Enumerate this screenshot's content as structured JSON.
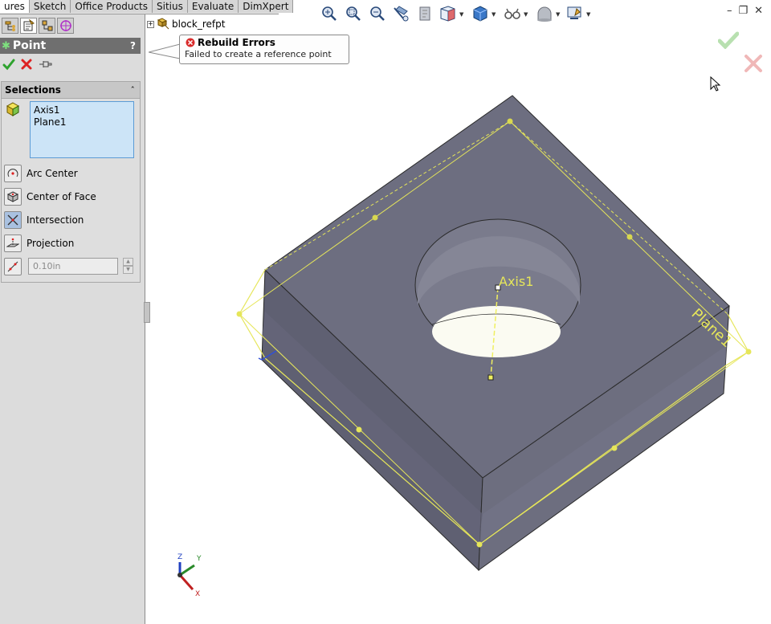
{
  "tabs": [
    {
      "label": "ures",
      "active": true
    },
    {
      "label": "Sketch",
      "active": false
    },
    {
      "label": "Office Products",
      "active": false
    },
    {
      "label": "Sitius",
      "active": false
    },
    {
      "label": "Evaluate",
      "active": false
    },
    {
      "label": "DimXpert",
      "active": false
    }
  ],
  "property_manager": {
    "title": "Point",
    "help": "?",
    "selections": {
      "header": "Selections",
      "items": [
        "Axis1",
        "Plane1"
      ]
    },
    "options": [
      {
        "label": "Arc Center",
        "icon": "arc-center-icon"
      },
      {
        "label": "Center of Face",
        "icon": "center-of-face-icon"
      },
      {
        "label": "Intersection",
        "icon": "intersection-icon"
      },
      {
        "label": "Projection",
        "icon": "projection-icon"
      }
    ],
    "distance": {
      "value": "0.10in"
    }
  },
  "tree": {
    "root": "block_refpt"
  },
  "rebuild_error": {
    "title": "Rebuild Errors",
    "message": "Failed to create a reference point"
  },
  "heads_up_icons": [
    "zoom-to-fit-icon",
    "zoom-to-area-icon",
    "previous-view-icon",
    "section-view-icon",
    "dynamic-annotation-icon",
    "view-orientation-icon",
    "display-style-icon",
    "hide-show-items-icon",
    "apply-scene-icon",
    "view-settings-icon"
  ],
  "model_labels": {
    "axis": "Axis1",
    "plane": "Plane1"
  },
  "triad_labels": {
    "x": "X",
    "y": "Y",
    "z": "Z"
  },
  "colors": {
    "accent_ok": "#3cb43c",
    "accent_cancel": "#d93030",
    "model_face": "#6d6e80",
    "preview": "#e8e84a"
  }
}
